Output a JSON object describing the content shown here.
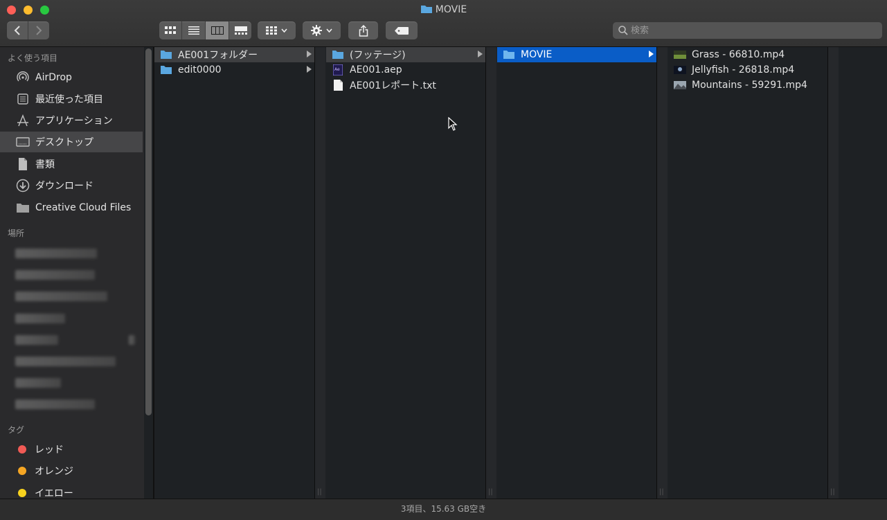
{
  "window": {
    "title": "MOVIE"
  },
  "toolbar": {
    "search_placeholder": "検索"
  },
  "sidebar": {
    "favorites_header": "よく使う項目",
    "favorites": [
      {
        "label": "AirDrop",
        "icon": "airdrop-icon"
      },
      {
        "label": "最近使った項目",
        "icon": "recents-icon"
      },
      {
        "label": "アプリケーション",
        "icon": "applications-icon"
      },
      {
        "label": "デスクトップ",
        "icon": "desktop-icon",
        "selected": true
      },
      {
        "label": "書類",
        "icon": "documents-icon"
      },
      {
        "label": "ダウンロード",
        "icon": "downloads-icon"
      },
      {
        "label": "Creative Cloud Files",
        "icon": "folder-icon"
      }
    ],
    "locations_header": "場所",
    "tags_header": "タグ",
    "tags": [
      {
        "label": "レッド",
        "color": "#f05a55"
      },
      {
        "label": "オレンジ",
        "color": "#f5a623"
      },
      {
        "label": "イエロー",
        "color": "#f7d21e"
      }
    ]
  },
  "columns": [
    {
      "items": [
        {
          "label": "AE001フォルダー",
          "type": "folder",
          "state": "path",
          "has_children": true
        },
        {
          "label": "edit0000",
          "type": "folder",
          "state": "none",
          "has_children": true
        }
      ]
    },
    {
      "items": [
        {
          "label": "(フッテージ)",
          "type": "folder",
          "state": "path",
          "has_children": true
        },
        {
          "label": "AE001.aep",
          "type": "ae-project",
          "state": "none",
          "has_children": false
        },
        {
          "label": "AE001レポート.txt",
          "type": "text",
          "state": "none",
          "has_children": false
        }
      ]
    },
    {
      "items": [
        {
          "label": "MOVIE",
          "type": "folder",
          "state": "selected",
          "has_children": true
        }
      ]
    },
    {
      "items": [
        {
          "label": "Grass - 66810.mp4",
          "type": "video",
          "state": "none",
          "has_children": false
        },
        {
          "label": "Jellyfish - 26818.mp4",
          "type": "video",
          "state": "none",
          "has_children": false
        },
        {
          "label": "Mountains - 59291.mp4",
          "type": "video",
          "state": "none",
          "has_children": false
        }
      ]
    }
  ],
  "status": {
    "text": "3項目、15.63 GB空き"
  },
  "colors": {
    "selection_blue": "#0a5dc7",
    "folder_blue": "#5aa7e0"
  }
}
